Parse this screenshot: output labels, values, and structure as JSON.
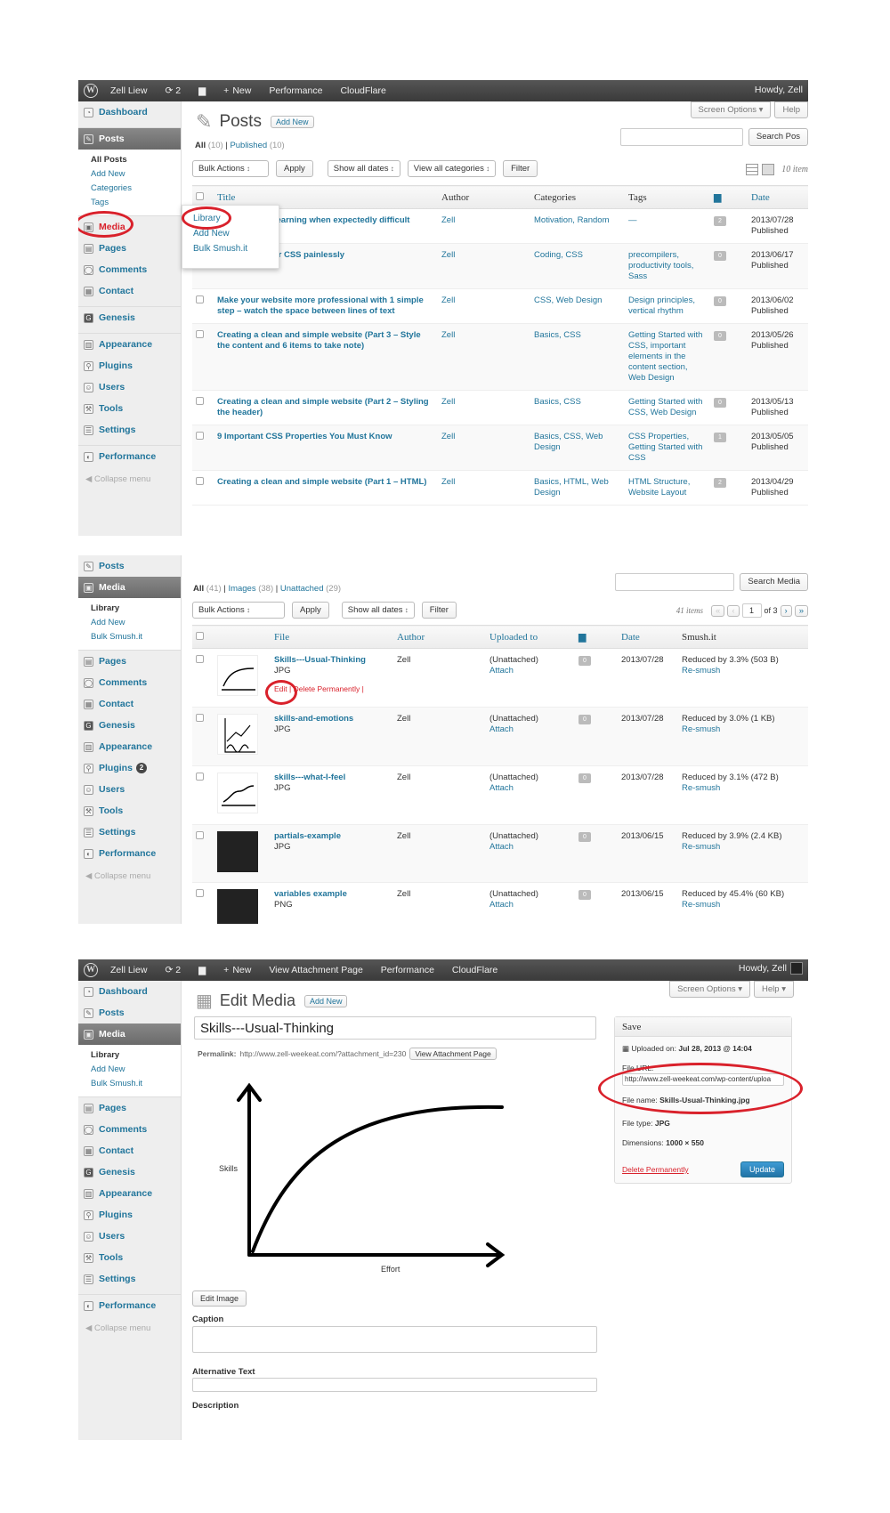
{
  "admin_bar": {
    "site": "Zell Liew",
    "updates": "2",
    "new_label": "New",
    "performance": "Performance",
    "cloudflare": "CloudFlare",
    "howdy": "Howdy, Zell",
    "view_attachment": "View Attachment Page"
  },
  "sidebar": {
    "dashboard": "Dashboard",
    "posts": "Posts",
    "posts_sub": [
      "All Posts",
      "Add New",
      "Categories",
      "Tags"
    ],
    "media": "Media",
    "media_sub": [
      "Library",
      "Add New",
      "Bulk Smush.it"
    ],
    "pages": "Pages",
    "comments": "Comments",
    "contact": "Contact",
    "genesis": "Genesis",
    "appearance": "Appearance",
    "plugins": "Plugins",
    "plugins_badge": "2",
    "users": "Users",
    "tools": "Tools",
    "settings": "Settings",
    "performance": "Performance",
    "collapse": "Collapse menu"
  },
  "posts_screen": {
    "title": "Posts",
    "add_new": "Add New",
    "screen_options": "Screen Options",
    "help": "Help",
    "filter_all": "All",
    "filter_all_count": "(10)",
    "filter_published": "Published",
    "filter_published_count": "(10)",
    "search_button": "Search Pos",
    "bulk_actions": "Bulk Actions",
    "apply": "Apply",
    "all_dates": "Show all dates",
    "all_categories": "View all categories",
    "filter": "Filter",
    "items_count": "10 item",
    "flyout": [
      "Library",
      "Add New",
      "Bulk Smush.it"
    ],
    "columns": {
      "title": "Title",
      "author": "Author",
      "categories": "Categories",
      "tags": "Tags",
      "date": "Date"
    },
    "rows": [
      {
        "title": "an do to keep learning when expectedly difficult",
        "author": "Zell",
        "categories": "Motivation, Random",
        "tags": "—",
        "comments": "2",
        "date": "2013/07/28",
        "status": "Published"
      },
      {
        "title": "ze and edit your CSS painlessly",
        "author": "Zell",
        "categories": "Coding, CSS",
        "tags": "precompilers, productivity tools, Sass",
        "comments": "0",
        "date": "2013/06/17",
        "status": "Published"
      },
      {
        "title": "Make your website more professional with 1 simple step – watch the space between lines of text",
        "author": "Zell",
        "categories": "CSS, Web Design",
        "tags": "Design principles, vertical rhythm",
        "comments": "0",
        "date": "2013/06/02",
        "status": "Published"
      },
      {
        "title": "Creating a clean and simple website (Part 3 – Style the content and 6 items to take note)",
        "author": "Zell",
        "categories": "Basics, CSS",
        "tags": "Getting Started with CSS, important elements in the content section, Web Design",
        "comments": "0",
        "date": "2013/05/26",
        "status": "Published"
      },
      {
        "title": "Creating a clean and simple website (Part 2 – Styling the header)",
        "author": "Zell",
        "categories": "Basics, CSS",
        "tags": "Getting Started with CSS, Web Design",
        "comments": "0",
        "date": "2013/05/13",
        "status": "Published"
      },
      {
        "title": "9 Important CSS Properties You Must Know",
        "author": "Zell",
        "categories": "Basics, CSS, Web Design",
        "tags": "CSS Properties, Getting Started with CSS",
        "comments": "1",
        "date": "2013/05/05",
        "status": "Published"
      },
      {
        "title": "Creating a clean and simple website (Part 1 – HTML)",
        "author": "Zell",
        "categories": "Basics, HTML, Web Design",
        "tags": "HTML Structure, Website Layout",
        "comments": "2",
        "date": "2013/04/29",
        "status": "Published"
      }
    ]
  },
  "media_screen": {
    "filter_all": "All",
    "filter_all_count": "(41)",
    "filter_images": "Images",
    "filter_images_count": "(38)",
    "filter_unattached": "Unattached",
    "filter_unattached_count": "(29)",
    "search_button": "Search Media",
    "bulk_actions": "Bulk Actions",
    "apply": "Apply",
    "all_dates": "Show all dates",
    "filter": "Filter",
    "items": "41 items",
    "page_current": "1",
    "page_total": "of 3",
    "columns": {
      "file": "File",
      "author": "Author",
      "uploaded_to": "Uploaded to",
      "date": "Date",
      "smush": "Smush.it"
    },
    "row_actions": "Edit | Delete Permanently |",
    "rows": [
      {
        "name": "Skills---Usual-Thinking",
        "type": "JPG",
        "author": "Zell",
        "uploaded": "(Unattached)",
        "attach": "Attach",
        "comments": "0",
        "date": "2013/07/28",
        "smush": "Reduced by 3.3% (503 B)",
        "resmush": "Re-smush",
        "thumb": "curve"
      },
      {
        "name": "skills-and-emotions",
        "type": "JPG",
        "author": "Zell",
        "uploaded": "(Unattached)",
        "attach": "Attach",
        "comments": "0",
        "date": "2013/07/28",
        "smush": "Reduced by 3.0% (1 KB)",
        "resmush": "Re-smush",
        "thumb": "wave"
      },
      {
        "name": "skills---what-I-feel",
        "type": "JPG",
        "author": "Zell",
        "uploaded": "(Unattached)",
        "attach": "Attach",
        "comments": "0",
        "date": "2013/07/28",
        "smush": "Reduced by 3.1% (472 B)",
        "resmush": "Re-smush",
        "thumb": "steps"
      },
      {
        "name": "partials-example",
        "type": "JPG",
        "author": "Zell",
        "uploaded": "(Unattached)",
        "attach": "Attach",
        "comments": "0",
        "date": "2013/06/15",
        "smush": "Reduced by 3.9% (2.4 KB)",
        "resmush": "Re-smush",
        "thumb": "dark"
      },
      {
        "name": "variables example",
        "type": "PNG",
        "author": "Zell",
        "uploaded": "(Unattached)",
        "attach": "Attach",
        "comments": "0",
        "date": "2013/06/15",
        "smush": "Reduced by 45.4% (60 KB)",
        "resmush": "Re-smush",
        "thumb": "dark"
      }
    ]
  },
  "edit_screen": {
    "title": "Edit Media",
    "add_new": "Add New",
    "screen_options": "Screen Options",
    "help": "Help",
    "media_title": "Skills---Usual-Thinking",
    "permalink_label": "Permalink:",
    "permalink_url": "http://www.zell-weekeat.com/?attachment_id=230",
    "view_attachment": "View Attachment Page",
    "image_ylabel": "Skills",
    "image_xlabel": "Effort",
    "edit_image": "Edit Image",
    "caption_label": "Caption",
    "alt_label": "Alternative Text",
    "description_label": "Description",
    "save_title": "Save",
    "uploaded_on_label": "Uploaded on:",
    "uploaded_on_value": "Jul 28, 2013 @ 14:04",
    "file_url_label": "File URL:",
    "file_url_value": "http://www.zell-weekeat.com/wp-content/uploa",
    "file_name_label": "File name:",
    "file_name_value": "Skills-Usual-Thinking.jpg",
    "file_type_label": "File type:",
    "file_type_value": "JPG",
    "dimensions_label": "Dimensions:",
    "dimensions_value": "1000 × 550",
    "delete": "Delete Permanently",
    "update": "Update"
  },
  "colors": {
    "link": "#21759b",
    "annotation": "#d9212b",
    "admin_bar": "#464646",
    "update_button": "#2e8cc4"
  }
}
